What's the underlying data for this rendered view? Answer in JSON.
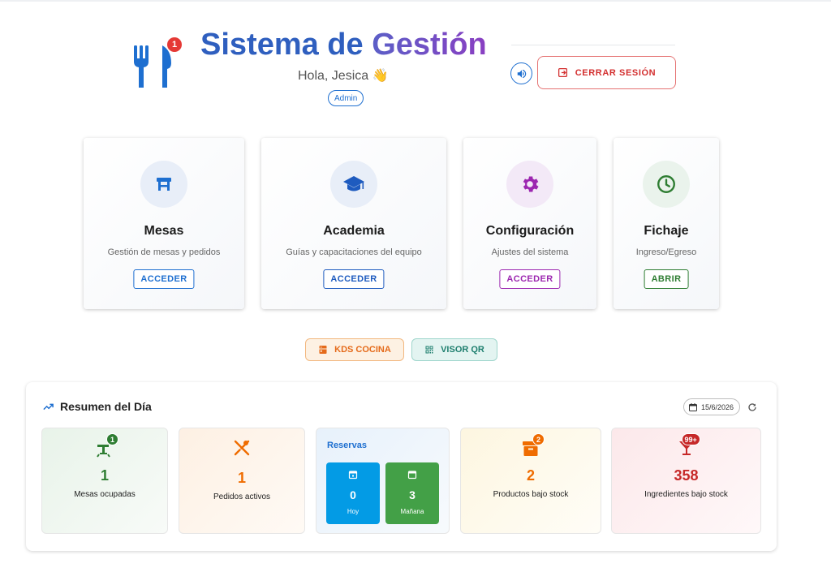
{
  "header": {
    "logo_badge": "1",
    "title_part1": "Sistema de",
    "title_part2": "Gestión",
    "greeting": "Hola, Jesica 👋",
    "role": "Admin",
    "logout_label": "CERRAR SESIÓN"
  },
  "cards": [
    {
      "title": "Mesas",
      "description": "Gestión de mesas y pedidos",
      "button": "ACCEDER",
      "icon": "table-icon",
      "color": "#1e6fd0"
    },
    {
      "title": "Academia",
      "description": "Guías y capacitaciones del equipo",
      "button": "ACCEDER",
      "icon": "graduation-cap-icon",
      "color": "#1e5bbf"
    },
    {
      "title": "Configuración",
      "description": "Ajustes del sistema",
      "button": "ACCEDER",
      "icon": "gear-icon",
      "color": "#9c27b0"
    },
    {
      "title": "Fichaje",
      "description": "Ingreso/Egreso",
      "button": "ABRIR",
      "icon": "clock-icon",
      "color": "#2e7d32"
    }
  ],
  "shortcuts": {
    "kds_label": "KDS COCINA",
    "qr_label": "VISOR QR"
  },
  "summary": {
    "title": "Resumen del Día",
    "date": "15/6/2026",
    "stats": {
      "mesas": {
        "value": "1",
        "label": "Mesas ocupadas",
        "badge": "1",
        "color": "#2e7d32"
      },
      "pedidos": {
        "value": "1",
        "label": "Pedidos activos",
        "color": "#ef6c00"
      },
      "reservas": {
        "title": "Reservas",
        "hoy": {
          "value": "0",
          "label": "Hoy"
        },
        "manana": {
          "value": "3",
          "label": "Mañana"
        }
      },
      "productos": {
        "value": "2",
        "label": "Productos bajo stock",
        "badge": "2",
        "color": "#ef6c00"
      },
      "ingredientes": {
        "value": "358",
        "label": "Ingredientes bajo stock",
        "badge": "99+",
        "color": "#c62828"
      }
    }
  }
}
